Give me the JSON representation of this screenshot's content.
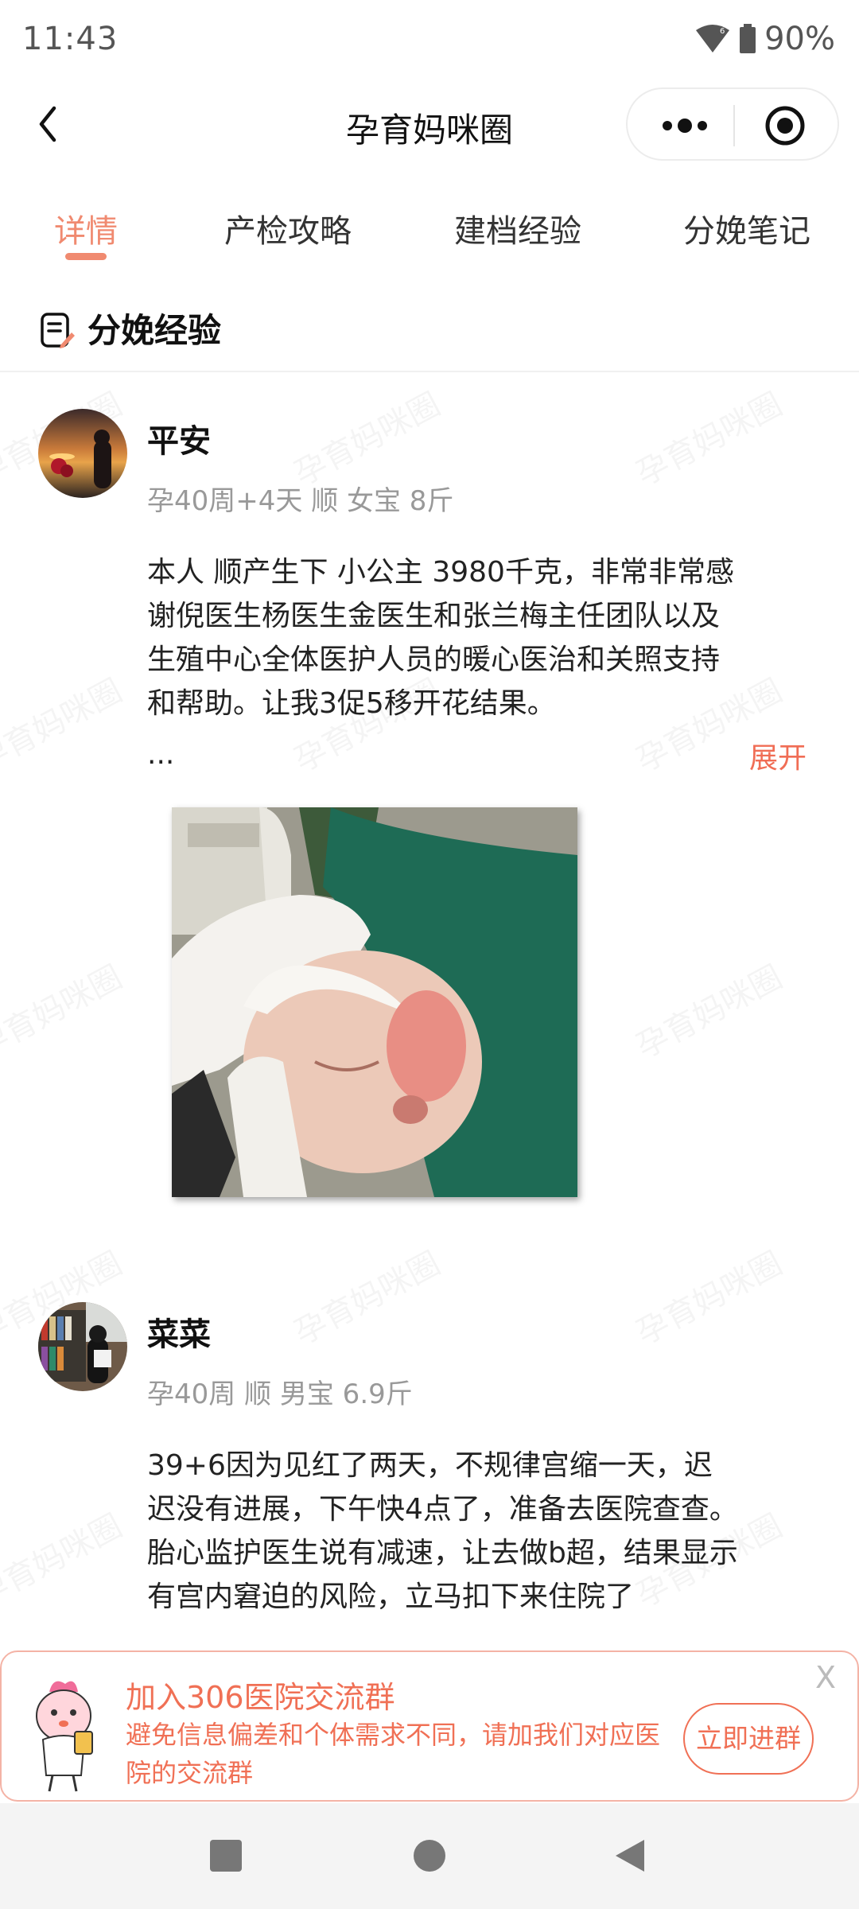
{
  "status_bar": {
    "time": "11:43",
    "battery": "90%",
    "icons": [
      "wifi-icon",
      "battery-icon"
    ]
  },
  "nav": {
    "title": "孕育妈咪圈",
    "back_icon": "chevron-left-icon",
    "more_icon": "more-dots-icon",
    "close_icon": "target-close-icon"
  },
  "tabs": [
    {
      "label": "详情",
      "active": true
    },
    {
      "label": "产检攻略",
      "active": false
    },
    {
      "label": "建档经验",
      "active": false
    },
    {
      "label": "分娩笔记",
      "active": false
    }
  ],
  "section": {
    "title": "分娩经验",
    "icon": "note-edit-icon"
  },
  "watermark_text": "孕育妈咪圈",
  "posts": [
    {
      "username": "平安",
      "meta": "孕40周+4天 顺 女宝 8斤",
      "body": "本人 顺产生下 小公主 3980千克，非常非常感谢倪医生杨医生金医生和张兰梅主任团队以及生殖中心全体医护人员的暖心医治和关照支持和帮助。让我3促5移开花结果。",
      "ellipsis": "...",
      "expand_label": "展开"
    },
    {
      "username": "菜菜",
      "meta": "孕40周 顺 男宝 6.9斤",
      "body": "39+6因为见红了两天，不规律宫缩一天，迟迟没有进展，下午快4点了，准备去医院查查。胎心监护医生说有减速，让去做b超，结果显示有宫内窘迫的风险，立马扣下来住院了"
    }
  ],
  "banner": {
    "title": "加入306医院交流群",
    "description": "避免信息偏差和个体需求不同，请加我们对应医院的交流群",
    "button_label": "立即进群",
    "close_label": "X"
  },
  "colors": {
    "accent": "#f08a70",
    "banner_text": "#f07055",
    "meta_gray": "#999999"
  }
}
